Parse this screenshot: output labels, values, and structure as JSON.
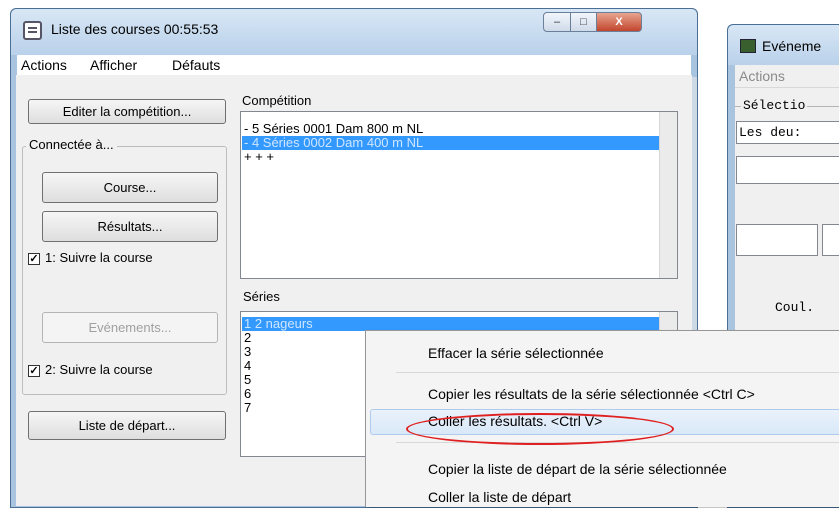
{
  "window": {
    "title": "Liste des courses  00:55:53",
    "controls": {
      "minimize": "–",
      "maximize": "□",
      "close": "X"
    }
  },
  "menu": {
    "items": [
      "Actions",
      "Afficher",
      "Défauts"
    ]
  },
  "left_panel": {
    "edit_competition": "Editer la compétition...",
    "connected_group": "Connectée à...",
    "course_button": "Course...",
    "results_button": "Résultats...",
    "follow1": {
      "label": "1: Suivre la course",
      "checked": "✓"
    },
    "events_button": "Evénements...",
    "follow2": {
      "label": "2: Suivre la course",
      "checked": "✓"
    },
    "start_list_button": "Liste de départ..."
  },
  "competition": {
    "label": "Compétition",
    "items": [
      "- 5 Séries 0001 Dam 800 m NL",
      "- 4 Séries 0002 Dam 400 m NL",
      "+ + +"
    ]
  },
  "series": {
    "label": "Séries",
    "items": [
      "1          2 nageurs",
      "2",
      "3",
      "4",
      "5",
      "6",
      "7"
    ]
  },
  "second_window": {
    "title": "Evéneme",
    "menu": "Actions",
    "selection_label": "Sélectio",
    "select_value": "Les deu:",
    "coul_label": "Coul."
  },
  "context_menu": {
    "items": [
      "Effacer la série sélectionnée",
      "Copier les résultats de la série sélectionnée  <Ctrl C>",
      "Coller les résultats.  <Ctrl V>",
      "Copier la liste de départ de la série sélectionnée",
      "Coller la liste de départ"
    ]
  }
}
